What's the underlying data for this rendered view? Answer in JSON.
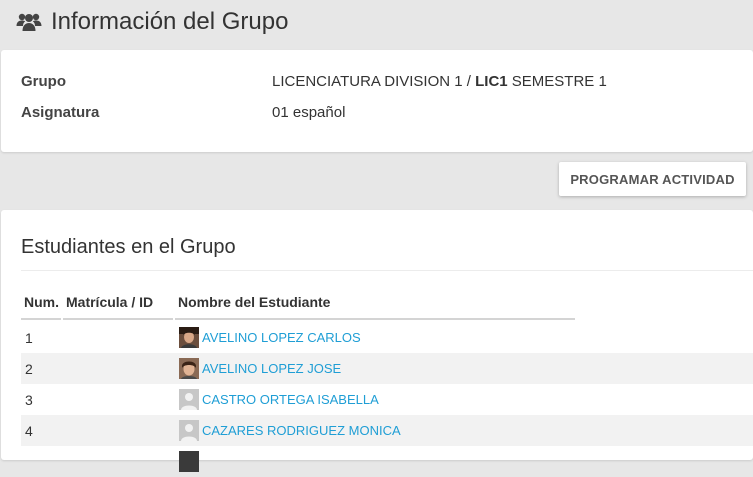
{
  "header": {
    "title": "Información del Grupo",
    "icon": "users-icon"
  },
  "info": {
    "grupo_label": "Grupo",
    "grupo_value_prefix": "LICENCIATURA DIVISION 1 / ",
    "grupo_value_bold": "LIC1",
    "grupo_value_suffix": " SEMESTRE 1",
    "asignatura_label": "Asignatura",
    "asignatura_value": "01 español"
  },
  "actions": {
    "programar_label": "PROGRAMAR ACTIVIDAD"
  },
  "students": {
    "title": "Estudiantes en el Grupo",
    "columns": {
      "num": "Num.",
      "matricula": "Matrícula / ID",
      "nombre": "Nombre del Estudiante"
    },
    "rows": [
      {
        "num": "1",
        "matricula": "",
        "name": "AVELINO LOPEZ CARLOS",
        "avatar": "photo"
      },
      {
        "num": "2",
        "matricula": "",
        "name": "AVELINO LOPEZ JOSE",
        "avatar": "photo"
      },
      {
        "num": "3",
        "matricula": "",
        "name": "CASTRO ORTEGA ISABELLA",
        "avatar": "placeholder"
      },
      {
        "num": "4",
        "matricula": "",
        "name": "CAZARES RODRIGUEZ MONICA",
        "avatar": "placeholder"
      }
    ]
  },
  "colors": {
    "link": "#1f9ed5",
    "background": "#e7e7e7",
    "card": "#ffffff",
    "row_alt": "#f2f2f2"
  }
}
